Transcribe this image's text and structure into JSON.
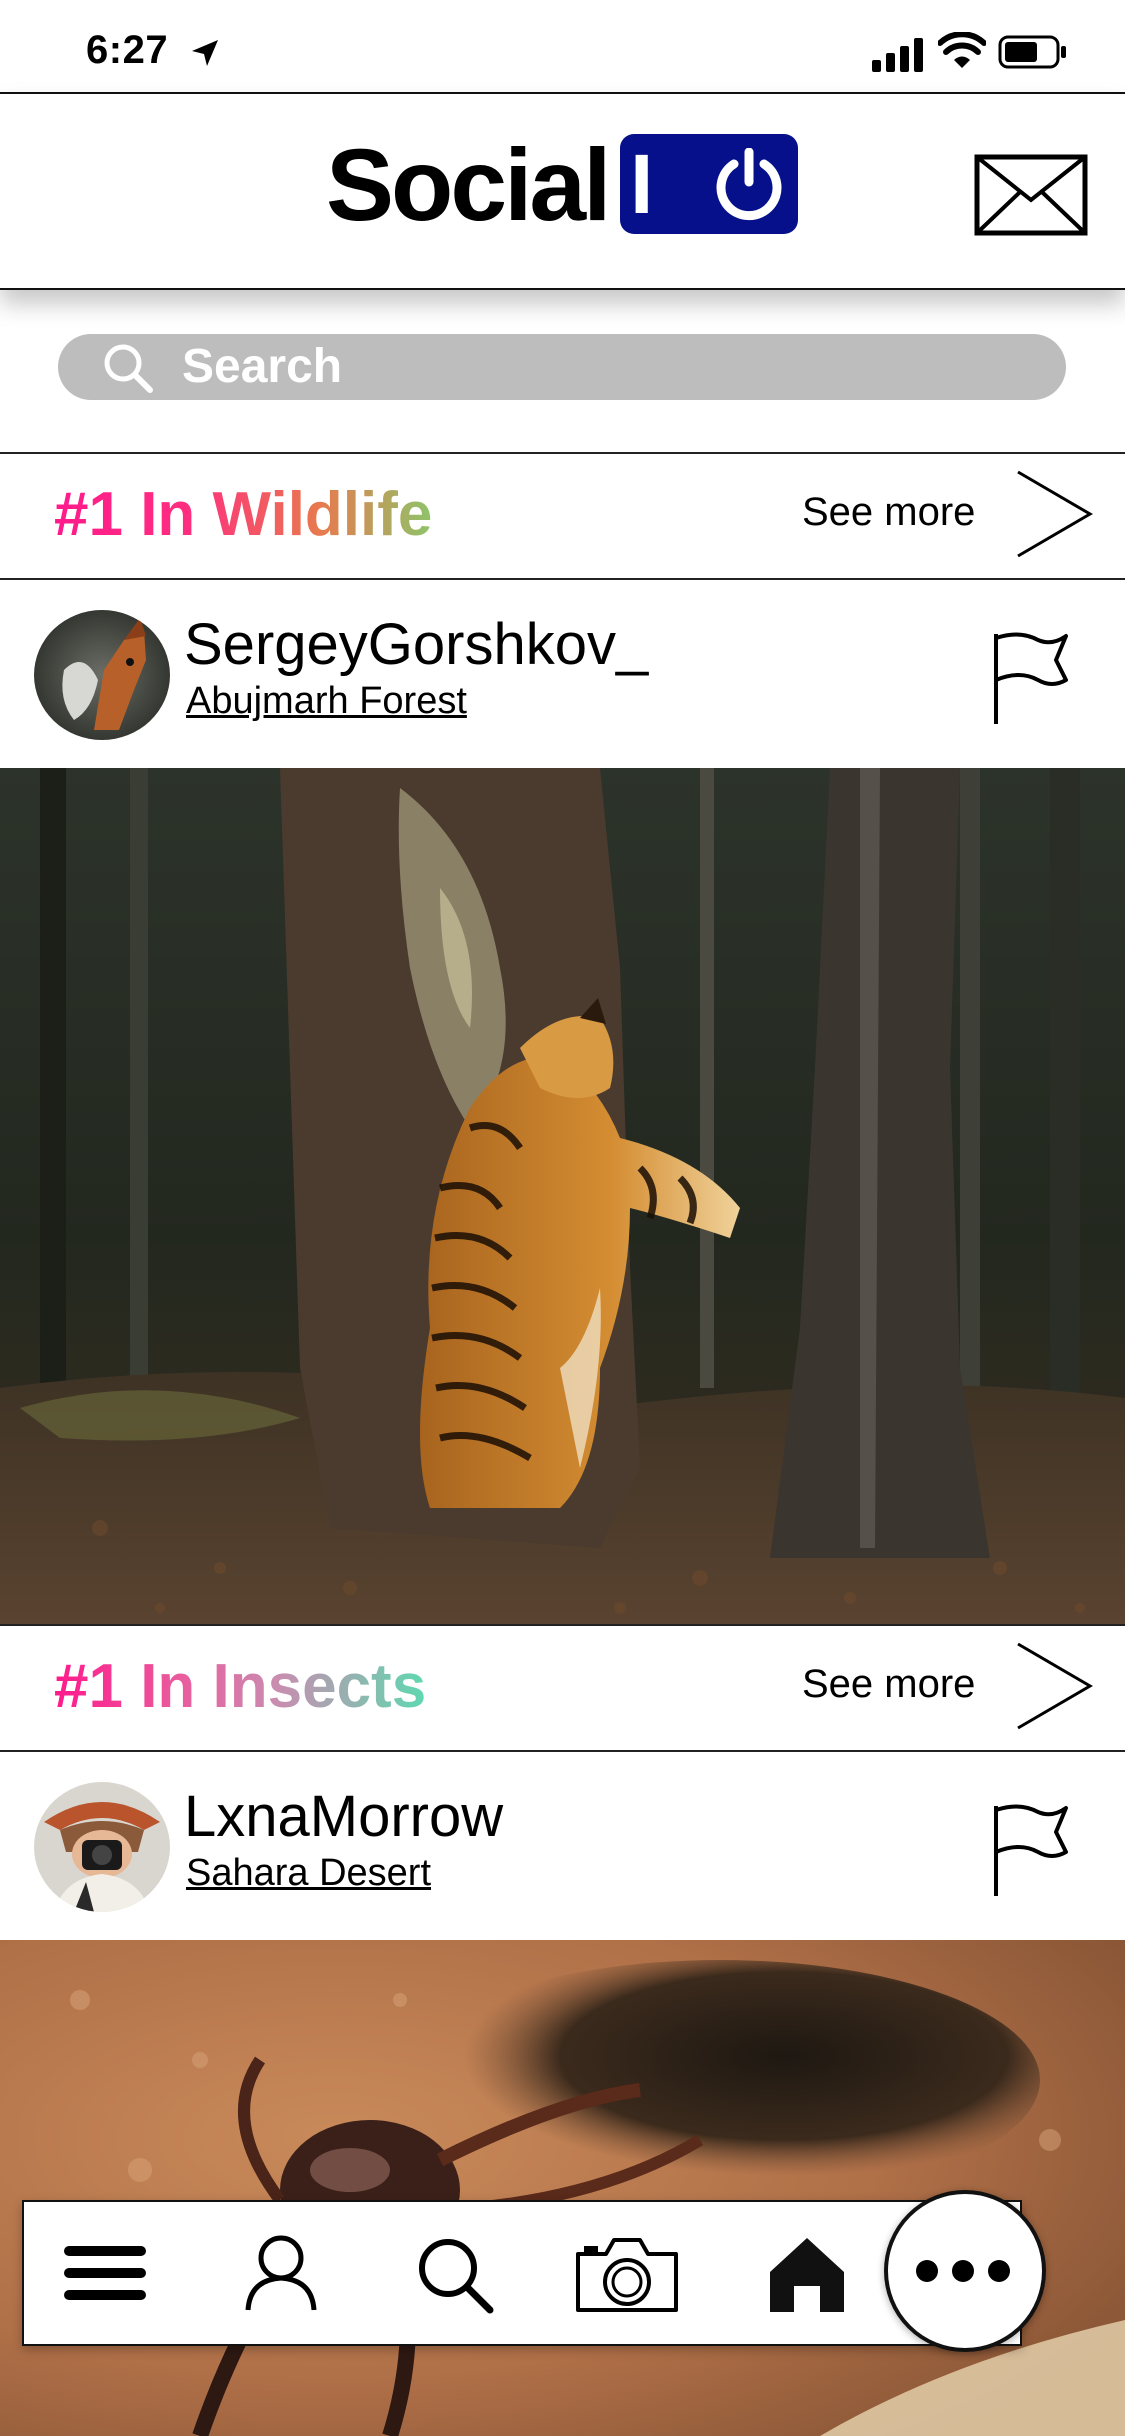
{
  "status_bar": {
    "time": "6:27"
  },
  "header": {
    "logo_text": "Social",
    "logo_badge": "IO"
  },
  "search": {
    "placeholder": "Search"
  },
  "sections": [
    {
      "category_title": "#1 In Wildlife",
      "see_more": "See more",
      "post": {
        "username": "SergeyGorshkov_",
        "location": "Abujmarh Forest"
      }
    },
    {
      "category_title": "#1 In Insects",
      "see_more": "See more",
      "post": {
        "username": "LxnaMorrow",
        "location": "Sahara Desert"
      }
    }
  ],
  "colors": {
    "brand": "#06108a",
    "search_bg": "#bdbdbd",
    "pink": "#ff1a8c"
  },
  "bottom_nav": {
    "items": [
      "menu-icon",
      "profile-icon",
      "search-icon",
      "camera-icon",
      "home-icon",
      "more-icon"
    ]
  }
}
